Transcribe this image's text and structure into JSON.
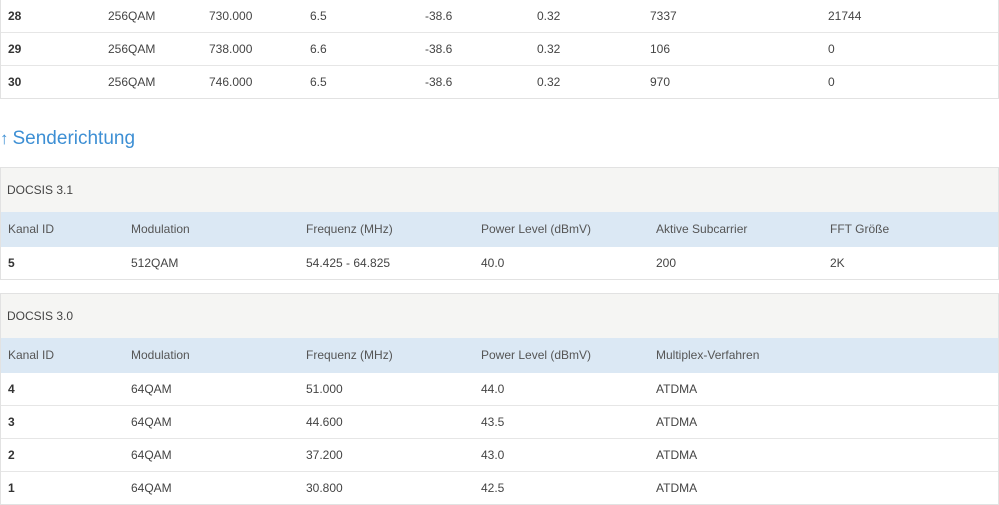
{
  "downstream_fragment": {
    "rows": [
      {
        "id": "28",
        "modulation": "256QAM",
        "frequency": "730.000",
        "power": "6.5",
        "mse": "-38.6",
        "latency": "0.32",
        "corr": "7337",
        "noncorr": "21744"
      },
      {
        "id": "29",
        "modulation": "256QAM",
        "frequency": "738.000",
        "power": "6.6",
        "mse": "-38.6",
        "latency": "0.32",
        "corr": "106",
        "noncorr": "0"
      },
      {
        "id": "30",
        "modulation": "256QAM",
        "frequency": "746.000",
        "power": "6.5",
        "mse": "-38.6",
        "latency": "0.32",
        "corr": "970",
        "noncorr": "0"
      }
    ]
  },
  "upstream": {
    "arrow_glyph": "↑",
    "heading": "Senderichtung",
    "docsis31": {
      "caption": "DOCSIS 3.1",
      "headers": [
        "Kanal ID",
        "Modulation",
        "Frequenz (MHz)",
        "Power Level (dBmV)",
        "Aktive Subcarrier",
        "FFT Größe"
      ],
      "rows": [
        {
          "id": "5",
          "modulation": "512QAM",
          "frequency": "54.425 - 64.825",
          "power": "40.0",
          "subcarrier": "200",
          "fft": "2K"
        }
      ]
    },
    "docsis30": {
      "caption": "DOCSIS 3.0",
      "headers": [
        "Kanal ID",
        "Modulation",
        "Frequenz (MHz)",
        "Power Level (dBmV)",
        "Multiplex-Verfahren"
      ],
      "rows": [
        {
          "id": "4",
          "modulation": "64QAM",
          "frequency": "51.000",
          "power": "44.0",
          "multiplex": "ATDMA"
        },
        {
          "id": "3",
          "modulation": "64QAM",
          "frequency": "44.600",
          "power": "43.5",
          "multiplex": "ATDMA"
        },
        {
          "id": "2",
          "modulation": "64QAM",
          "frequency": "37.200",
          "power": "43.0",
          "multiplex": "ATDMA"
        },
        {
          "id": "1",
          "modulation": "64QAM",
          "frequency": "30.800",
          "power": "42.5",
          "multiplex": "ATDMA"
        }
      ]
    }
  }
}
